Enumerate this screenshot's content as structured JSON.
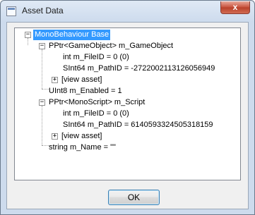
{
  "window": {
    "title": "Asset Data",
    "close_glyph": "x"
  },
  "tree": {
    "root": "MonoBehaviour Base",
    "game_object": "PPtr<GameObject> m_GameObject",
    "go_file_id": "int m_FileID = 0 (0)",
    "go_path_id": "SInt64 m_PathID = -2722002113126056949",
    "go_view_asset": "[view asset]",
    "enabled": "UInt8 m_Enabled = 1",
    "script": "PPtr<MonoScript> m_Script",
    "script_file_id": "int m_FileID = 0 (0)",
    "script_path_id": "SInt64 m_PathID = 6140593324505318159",
    "script_view_asset": "[view asset]",
    "name": "string m_Name = \"\"",
    "collapse_glyph": "−",
    "expand_glyph": "+"
  },
  "buttons": {
    "ok": "OK"
  }
}
